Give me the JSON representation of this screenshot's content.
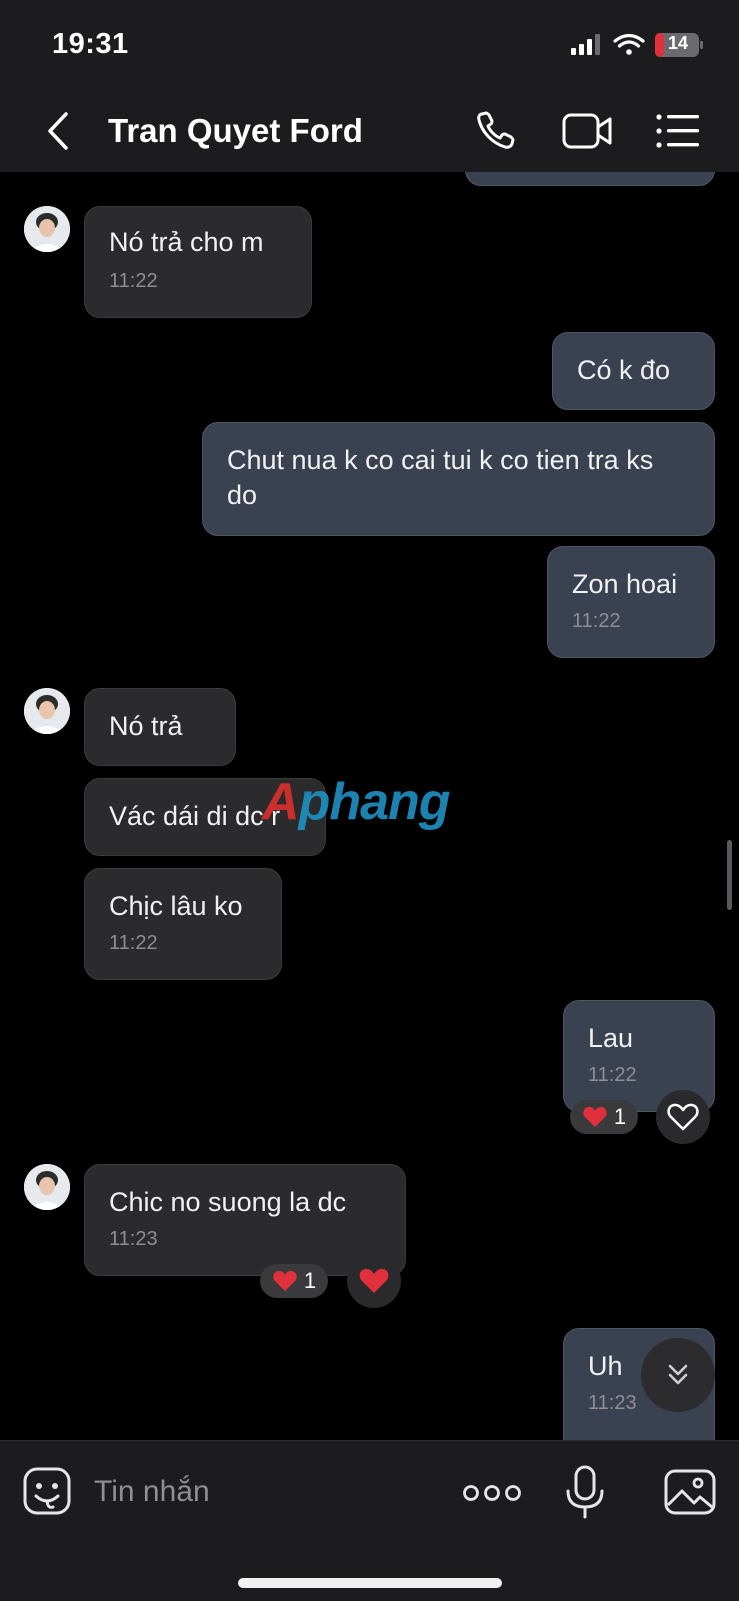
{
  "status_bar": {
    "time": "19:31",
    "battery": "14"
  },
  "header": {
    "title": "Tran Quyet Ford"
  },
  "messages": [
    {
      "text": "Nó trả cho m",
      "time": "11:22"
    },
    {
      "text": "Có k đo"
    },
    {
      "text": "Chut nua k co cai tui k co tien tra ks do"
    },
    {
      "text": "Zon hoai",
      "time": "11:22"
    },
    {
      "text": "Nó trả"
    },
    {
      "text": "Vác dái di dc r"
    },
    {
      "text": "Chịc lâu ko",
      "time": "11:22"
    },
    {
      "text": "Lau",
      "time": "11:22",
      "reaction_count": "1"
    },
    {
      "text": "Chic no suong la dc",
      "time": "11:23",
      "reaction_count": "1"
    },
    {
      "text": "Uh",
      "time": "11:23"
    }
  ],
  "watermark": {
    "part1": "A",
    "part2": "phang"
  },
  "composer": {
    "placeholder": "Tin nhắn"
  },
  "colors": {
    "incoming_bubble": "#2b2b2d",
    "outgoing_bubble": "#3a4150",
    "background": "#000000",
    "heart": "#e0303c"
  },
  "icons": [
    "back-icon",
    "phone-icon",
    "video-icon",
    "menu-list-icon",
    "sticker-icon",
    "more-icon",
    "microphone-icon",
    "image-icon",
    "heart-icon",
    "chevron-double-down-icon"
  ]
}
